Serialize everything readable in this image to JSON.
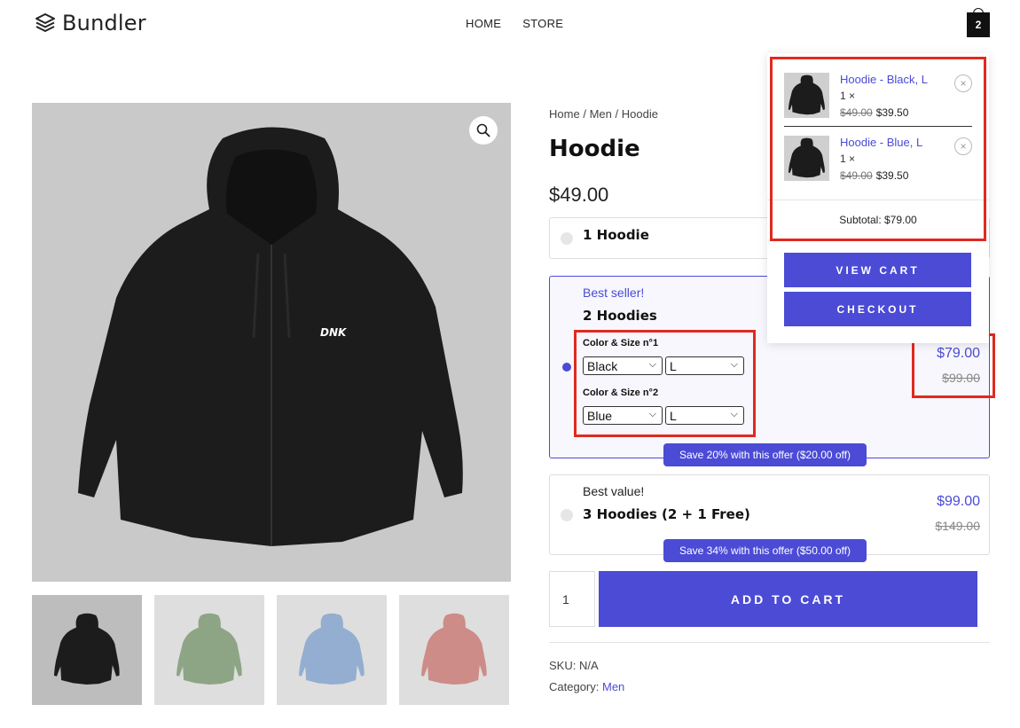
{
  "header": {
    "logo_icon": "stacked-layers-icon",
    "logo_text": "Bundler",
    "nav": [
      "HOME",
      "STORE"
    ],
    "cart_count": "2"
  },
  "gallery": {
    "zoom_icon": "magnifier-icon",
    "hoodie_logo": "DNK",
    "thumbnails": [
      {
        "color": "#1c1c1c",
        "bg": "#bdbdbd"
      },
      {
        "color": "#8da585",
        "bg": "#dedede"
      },
      {
        "color": "#93aed0",
        "bg": "#dedede"
      },
      {
        "color": "#cd8c87",
        "bg": "#dedede"
      }
    ]
  },
  "product": {
    "breadcrumb": [
      "Home",
      "Men",
      "Hoodie"
    ],
    "breadcrumb_sep": "/",
    "title": "Hoodie",
    "price": "$49.00",
    "offers": [
      {
        "name": "1 Hoodie",
        "selected": false
      },
      {
        "tag": "Best seller!",
        "name": "2 Hoodies",
        "selected": true,
        "price": "$79.00",
        "old_price": "$99.00",
        "save": "Save 20% with this offer ($20.00 off)",
        "variants": [
          {
            "label": "Color & Size n°1",
            "color": "Black",
            "size": "L"
          },
          {
            "label": "Color & Size n°2",
            "color": "Blue",
            "size": "L"
          }
        ]
      },
      {
        "tag": "Best value!",
        "name": "3 Hoodies (2 + 1 Free)",
        "selected": false,
        "price": "$99.00",
        "old_price": "$149.00",
        "save": "Save 34% with this offer ($50.00 off)"
      }
    ],
    "quantity": "1",
    "add_to_cart": "ADD TO CART",
    "sku_label": "SKU:",
    "sku_value": "N/A",
    "category_label": "Category:",
    "category_value": "Men"
  },
  "minicart": {
    "items": [
      {
        "name": "Hoodie - Black, L",
        "qty": "1 ×",
        "old_price": "$49.00",
        "price": "$39.50"
      },
      {
        "name": "Hoodie - Blue, L",
        "qty": "1 ×",
        "old_price": "$49.00",
        "price": "$39.50"
      }
    ],
    "remove_glyph": "×",
    "subtotal": "Subtotal: $79.00",
    "view_cart": "VIEW CART",
    "checkout": "CHECKOUT"
  },
  "colors": {
    "accent": "#4b4bd6",
    "annotation": "#e02a1f"
  }
}
